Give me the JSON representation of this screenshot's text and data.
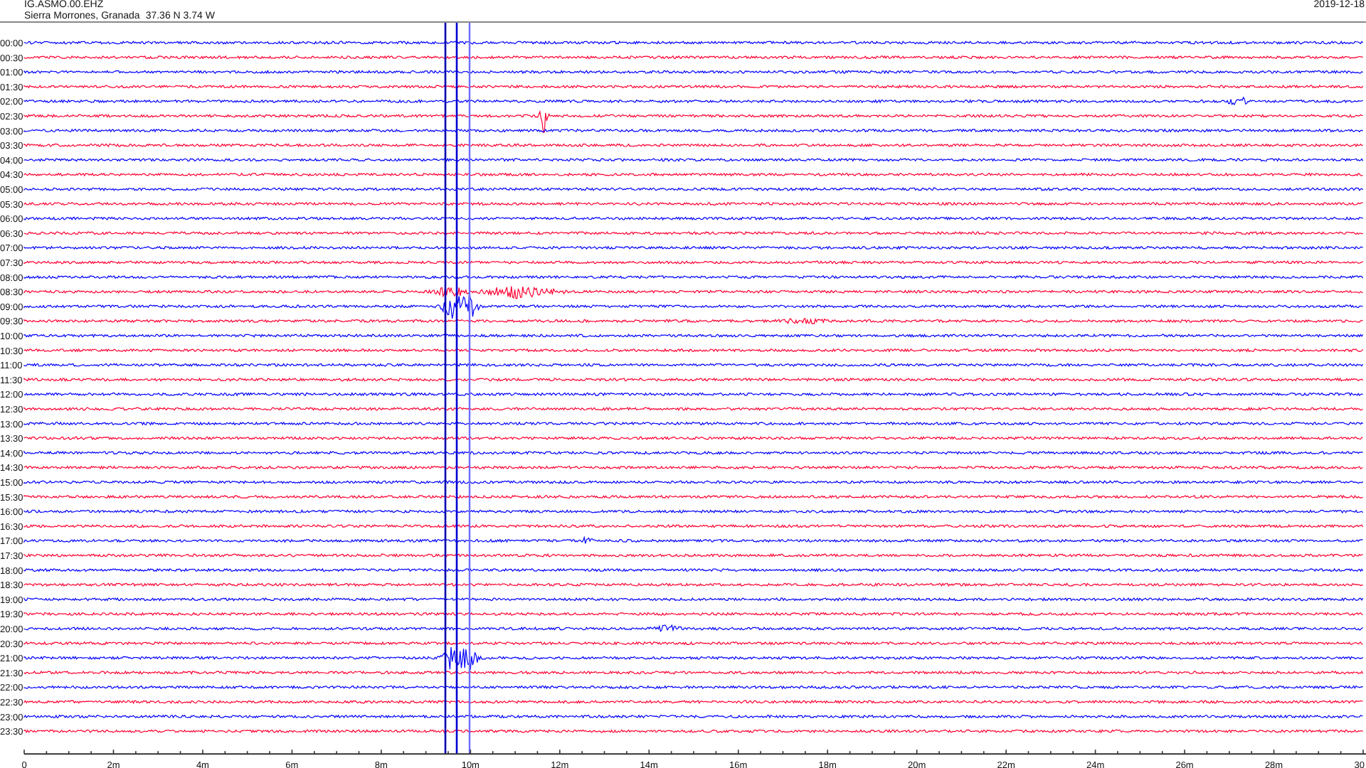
{
  "header": {
    "station": "IG.ASMO.00.EHZ",
    "location": "Sierra Morrones, Granada",
    "coordinates": "37.36 N 3.74 W",
    "date": "2019-12-18"
  },
  "rows": [
    {
      "label": "00:00",
      "color": "#0000ff"
    },
    {
      "label": "00:30",
      "color": "#ff0030"
    },
    {
      "label": "01:00",
      "color": "#0000ff"
    },
    {
      "label": "01:30",
      "color": "#ff0030"
    },
    {
      "label": "02:00",
      "color": "#0000ff"
    },
    {
      "label": "02:30",
      "color": "#ff0030"
    },
    {
      "label": "03:00",
      "color": "#0000ff"
    },
    {
      "label": "03:30",
      "color": "#ff0030"
    },
    {
      "label": "04:00",
      "color": "#0000ff"
    },
    {
      "label": "04:30",
      "color": "#ff0030"
    },
    {
      "label": "05:00",
      "color": "#0000ff"
    },
    {
      "label": "05:30",
      "color": "#ff0030"
    },
    {
      "label": "06:00",
      "color": "#0000ff"
    },
    {
      "label": "06:30",
      "color": "#ff0030"
    },
    {
      "label": "07:00",
      "color": "#0000ff"
    },
    {
      "label": "07:30",
      "color": "#ff0030"
    },
    {
      "label": "08:00",
      "color": "#0000ff"
    },
    {
      "label": "08:30",
      "color": "#ff0030"
    },
    {
      "label": "09:00",
      "color": "#0000ff"
    },
    {
      "label": "09:30",
      "color": "#ff0030"
    },
    {
      "label": "10:00",
      "color": "#0000ff"
    },
    {
      "label": "10:30",
      "color": "#ff0030"
    },
    {
      "label": "11:00",
      "color": "#0000ff"
    },
    {
      "label": "11:30",
      "color": "#ff0030"
    },
    {
      "label": "12:00",
      "color": "#0000ff"
    },
    {
      "label": "12:30",
      "color": "#ff0030"
    },
    {
      "label": "13:00",
      "color": "#0000ff"
    },
    {
      "label": "13:30",
      "color": "#ff0030"
    },
    {
      "label": "14:00",
      "color": "#0000ff"
    },
    {
      "label": "14:30",
      "color": "#ff0030"
    },
    {
      "label": "15:00",
      "color": "#0000ff"
    },
    {
      "label": "15:30",
      "color": "#ff0030"
    },
    {
      "label": "16:00",
      "color": "#0000ff"
    },
    {
      "label": "16:30",
      "color": "#ff0030"
    },
    {
      "label": "17:00",
      "color": "#0000ff"
    },
    {
      "label": "17:30",
      "color": "#ff0030"
    },
    {
      "label": "18:00",
      "color": "#0000ff"
    },
    {
      "label": "18:30",
      "color": "#ff0030"
    },
    {
      "label": "19:00",
      "color": "#0000ff"
    },
    {
      "label": "19:30",
      "color": "#ff0030"
    },
    {
      "label": "20:00",
      "color": "#0000ff"
    },
    {
      "label": "20:30",
      "color": "#ff0030"
    },
    {
      "label": "21:00",
      "color": "#0000ff"
    },
    {
      "label": "21:30",
      "color": "#ff0030"
    },
    {
      "label": "22:00",
      "color": "#0000ff"
    },
    {
      "label": "22:30",
      "color": "#ff0030"
    },
    {
      "label": "23:00",
      "color": "#0000ff"
    },
    {
      "label": "23:30",
      "color": "#ff0030"
    }
  ],
  "time_axis": {
    "ticks": [
      "0",
      "2m",
      "4m",
      "6m",
      "8m",
      "10m",
      "12m",
      "14m",
      "16m",
      "18m",
      "20m",
      "22m",
      "24m",
      "26m",
      "28m",
      "30"
    ]
  }
}
